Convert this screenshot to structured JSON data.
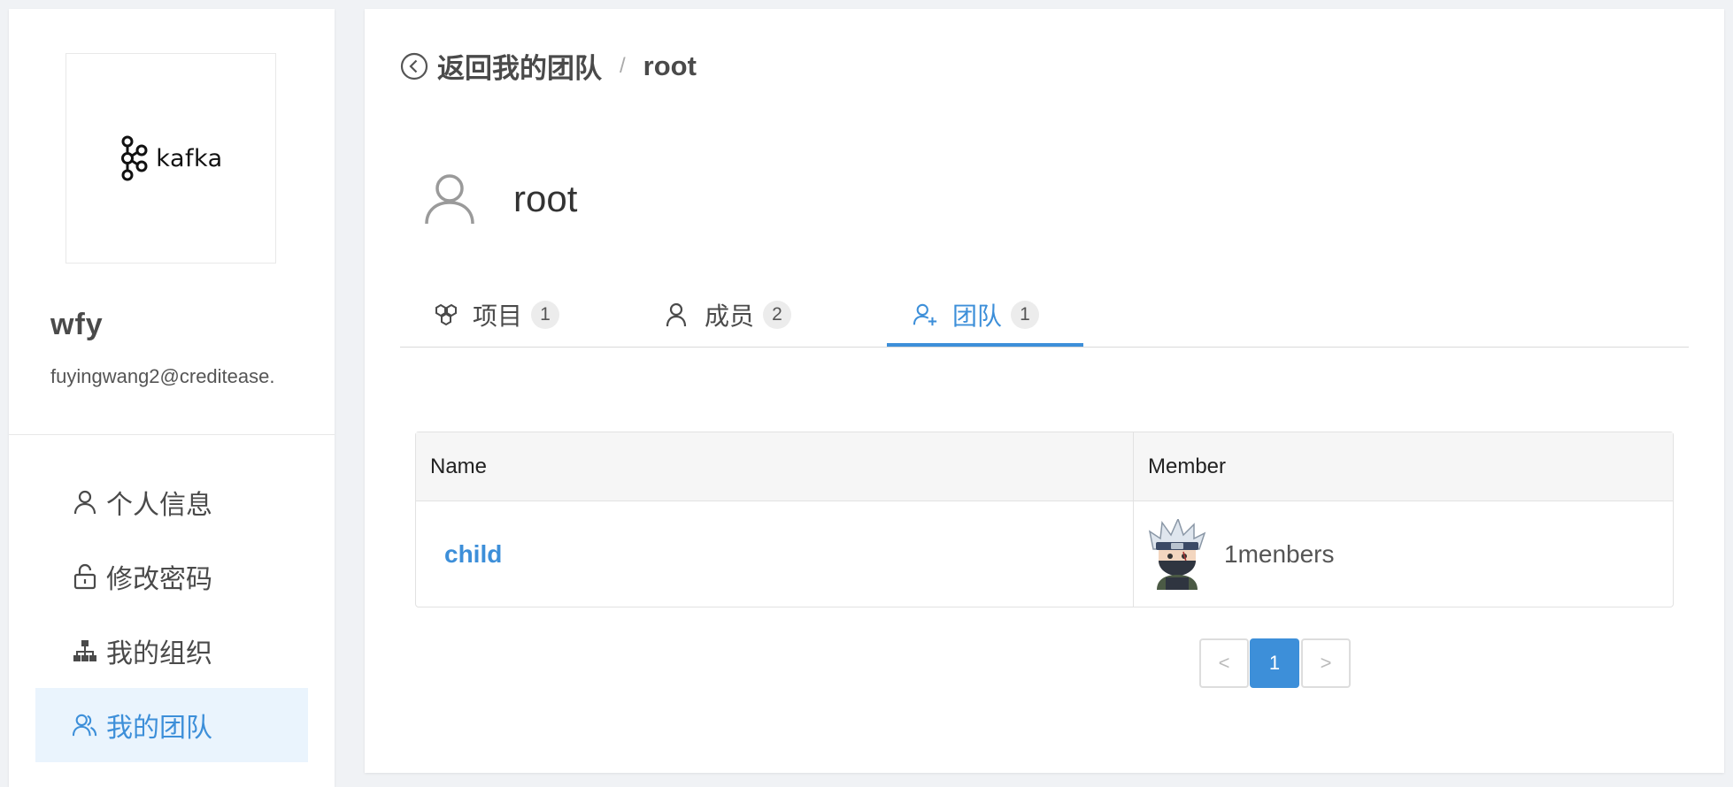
{
  "sidebar": {
    "logo_text": "kafka",
    "user_name": "wfy",
    "user_email": "fuyingwang2@creditease.",
    "nav": [
      {
        "label": "个人信息",
        "icon": "user-icon"
      },
      {
        "label": "修改密码",
        "icon": "lock-icon"
      },
      {
        "label": "我的组织",
        "icon": "org-chart-icon"
      },
      {
        "label": "我的团队",
        "icon": "team-icon"
      }
    ],
    "active_index": 3
  },
  "breadcrumb": {
    "back_label": "返回我的团队",
    "separator": "/",
    "current": "root"
  },
  "team": {
    "name": "root"
  },
  "tabs": [
    {
      "label": "项目",
      "count": "1",
      "icon": "project-icon"
    },
    {
      "label": "成员",
      "count": "2",
      "icon": "member-icon"
    },
    {
      "label": "团队",
      "count": "1",
      "icon": "team-add-icon"
    }
  ],
  "active_tab": 2,
  "table": {
    "columns": [
      "Name",
      "Member"
    ],
    "rows": [
      {
        "name": "child",
        "members": "1menbers"
      }
    ]
  },
  "pagination": {
    "prev": "<",
    "current": "1",
    "next": ">"
  },
  "colors": {
    "accent": "#3d8fd9",
    "active_bg": "#eaf4fd",
    "page_bg": "#f0f2f5"
  }
}
